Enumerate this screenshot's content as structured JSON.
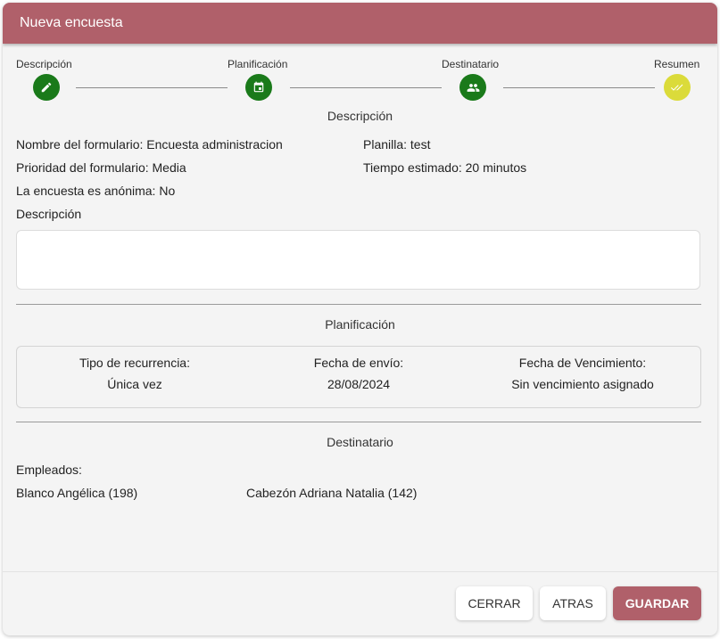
{
  "dialog": {
    "title": "Nueva encuesta"
  },
  "stepper": {
    "steps": [
      {
        "label": "Descripción",
        "icon": "pencil-icon"
      },
      {
        "label": "Planificación",
        "icon": "calendar-icon"
      },
      {
        "label": "Destinatario",
        "icon": "people-icon"
      },
      {
        "label": "Resumen",
        "icon": "double-check-icon"
      }
    ],
    "colors": {
      "done": "#1a7a1a",
      "current": "#dbdb3a"
    }
  },
  "description": {
    "section_title": "Descripción",
    "form_name": "Nombre del formulario: Encuesta administracion",
    "template": "Planilla: test",
    "priority": "Prioridad del formulario: Media",
    "estimated_time": "Tiempo estimado: 20 minutos",
    "anonymous": "La encuesta es anónima: No",
    "description_label": "Descripción",
    "description_value": ""
  },
  "planning": {
    "section_title": "Planificación",
    "recurrence_label": "Tipo de recurrencia:",
    "recurrence_value": "Única vez",
    "send_date_label": "Fecha de envío:",
    "send_date_value": "28/08/2024",
    "due_date_label": "Fecha de Vencimiento:",
    "due_date_value": "Sin vencimiento asignado"
  },
  "recipients": {
    "section_title": "Destinatario",
    "employees_label": "Empleados:",
    "employees": [
      "Blanco Angélica (198)",
      "Cabezón Adriana Natalia (142)"
    ]
  },
  "footer": {
    "close_label": "CERRAR",
    "back_label": "ATRAS",
    "save_label": "GUARDAR",
    "accent_color": "#b0606a"
  }
}
